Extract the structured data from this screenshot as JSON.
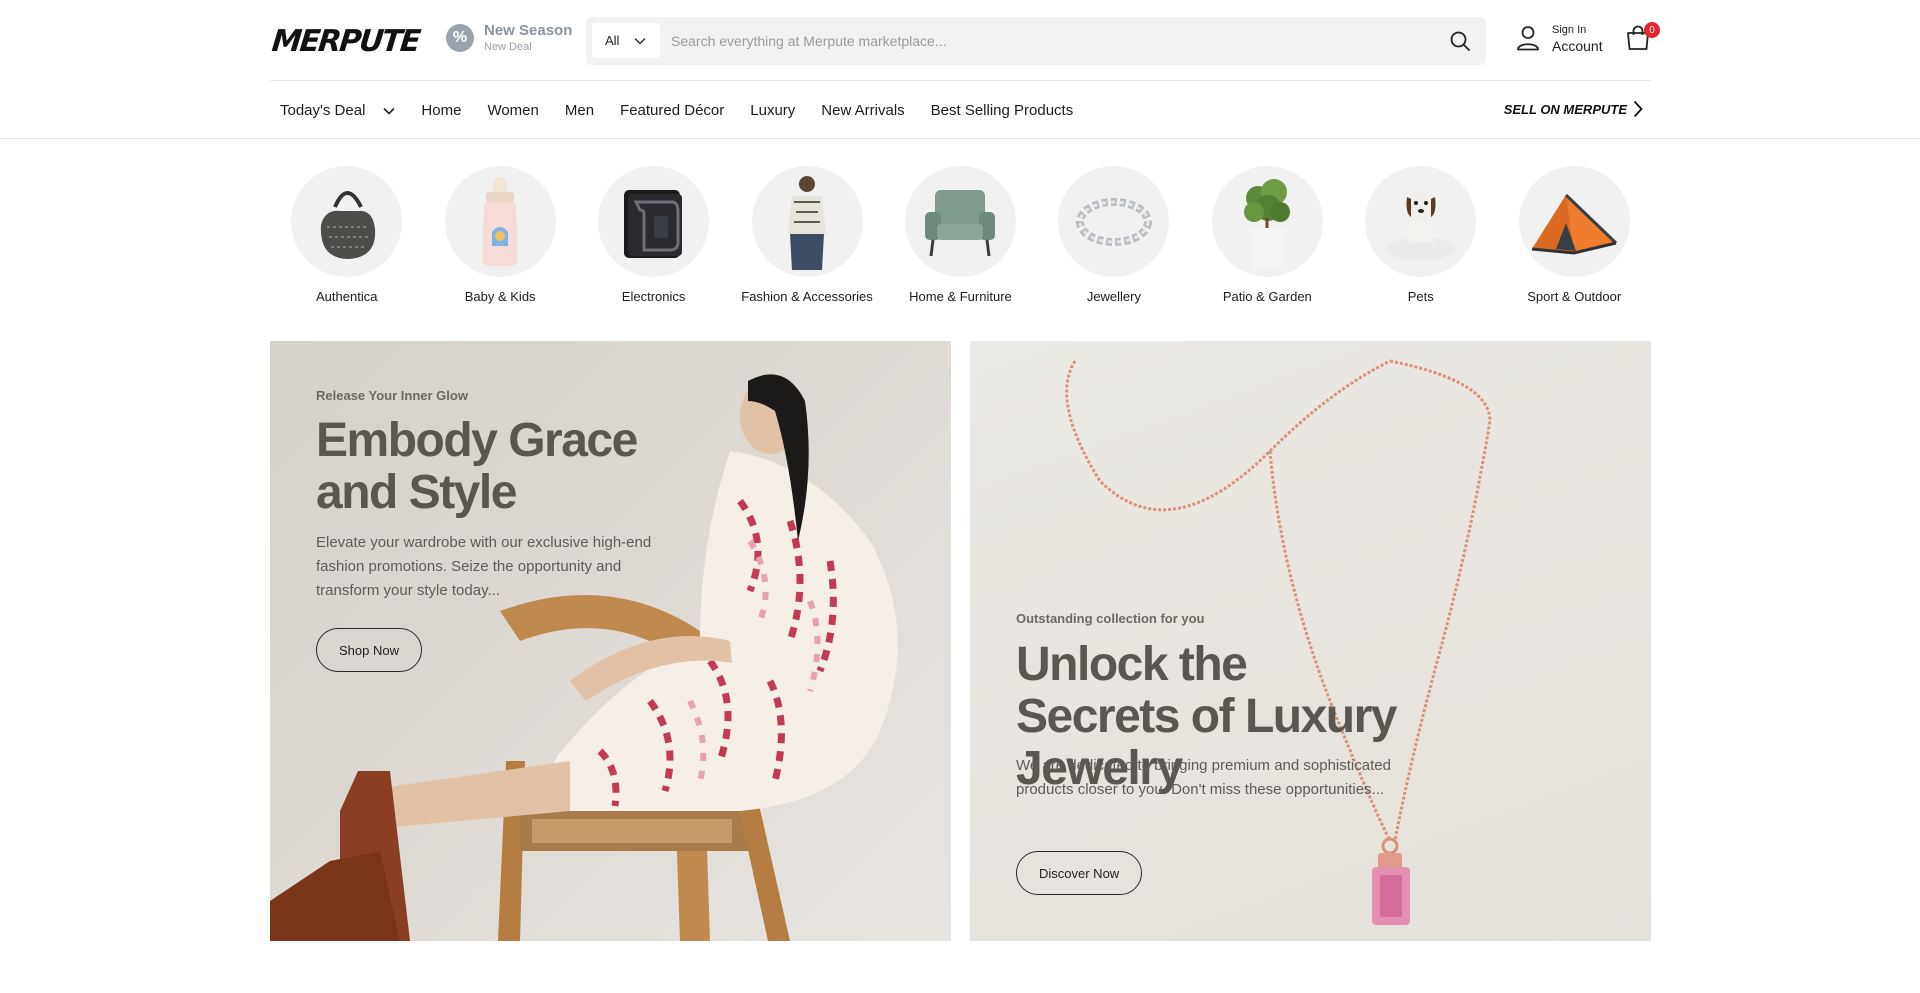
{
  "brand": {
    "logo": "MERPUTE"
  },
  "promo": {
    "title": "New Season",
    "subtitle": "New Deal"
  },
  "search": {
    "category": "All",
    "placeholder": "Search everything at Merpute marketplace..."
  },
  "account": {
    "line1": "Sign In",
    "line2": "Account"
  },
  "cart": {
    "count": "0"
  },
  "nav": {
    "items": [
      "Today's Deal",
      "Home",
      "Women",
      "Men",
      "Featured Décor",
      "Luxury",
      "New Arrivals",
      "Best Selling Products"
    ],
    "sell": "SELL ON MERPUTE"
  },
  "categories": [
    {
      "label": "Authentica",
      "icon": "handbag-icon"
    },
    {
      "label": "Baby & Kids",
      "icon": "baby-bottle-icon"
    },
    {
      "label": "Electronics",
      "icon": "tablet-icon"
    },
    {
      "label": "Fashion & Accessories",
      "icon": "blouse-icon"
    },
    {
      "label": "Home & Furniture",
      "icon": "armchair-icon"
    },
    {
      "label": "Jewellery",
      "icon": "chain-bracelet-icon"
    },
    {
      "label": "Patio & Garden",
      "icon": "potted-plant-icon"
    },
    {
      "label": "Pets",
      "icon": "dog-icon"
    },
    {
      "label": "Sport & Outdoor",
      "icon": "tent-icon"
    }
  ],
  "banners": [
    {
      "kicker": "Release Your Inner Glow",
      "title": "Embody Grace and Style",
      "text": "Elevate your wardrobe with our exclusive high-end fashion promotions. Seize the opportunity and transform your style today...",
      "button": "Shop Now"
    },
    {
      "kicker": "Outstanding collection for you",
      "title": "Unlock the Secrets of Luxury Jewelry",
      "text": "We are dedicated to bringing premium and sophisticated products closer to you. Don't miss these opportunities...",
      "button": "Discover Now"
    }
  ],
  "colors": {
    "badge": "#e3262f",
    "banner_text": "#5a5650"
  }
}
